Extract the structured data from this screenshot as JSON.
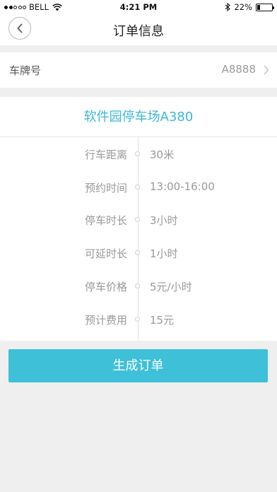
{
  "status_bar": {
    "carrier": "BELL",
    "time": "4:21 PM",
    "battery": "22%",
    "battery_level": 0.22
  },
  "nav": {
    "title": "订单信息"
  },
  "plate": {
    "label": "车牌号",
    "value": "A8888"
  },
  "lot": {
    "name": "软件园停车场A380"
  },
  "details": [
    {
      "label": "行车距离",
      "value": "30米"
    },
    {
      "label": "预约时间",
      "value": "13:00-16:00"
    },
    {
      "label": "停车时长",
      "value": "3小时"
    },
    {
      "label": "可延时长",
      "value": "1小时"
    },
    {
      "label": "停车价格",
      "value": "5元/小时"
    },
    {
      "label": "预计费用",
      "value": "15元"
    }
  ],
  "actions": {
    "submit_label": "生成订单"
  },
  "colors": {
    "accent": "#3ec0d8",
    "lot_text": "#3bb8d3",
    "background": "#efefef"
  }
}
